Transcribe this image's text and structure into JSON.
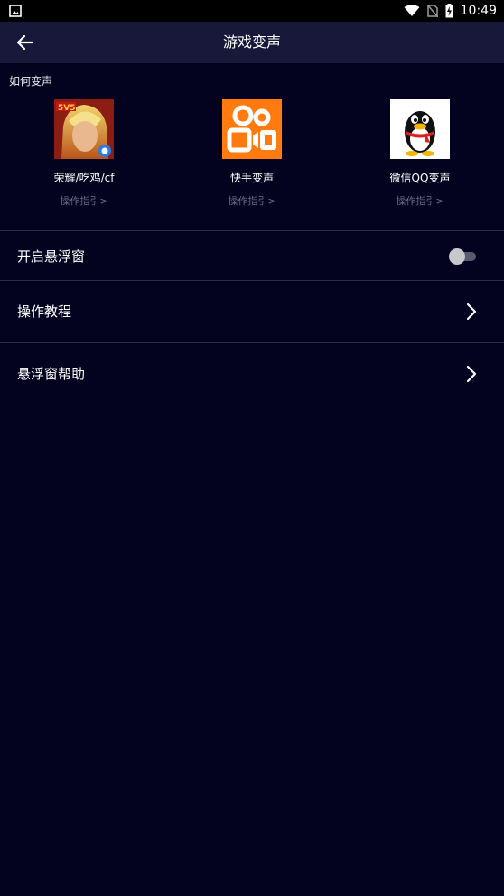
{
  "status_bar": {
    "time": "10:49",
    "icons": [
      "image-icon",
      "wifi-icon",
      "no-sim-icon",
      "battery-charging-icon"
    ]
  },
  "app_bar": {
    "title": "游戏变声",
    "back_icon": "arrow-left-icon"
  },
  "section": {
    "label": "如何变声"
  },
  "apps": [
    {
      "name": "荣耀/吃鸡/cf",
      "guide": "操作指引>",
      "icon": "game-hero-icon"
    },
    {
      "name": "快手变声",
      "guide": "操作指引>",
      "icon": "kuaishou-icon"
    },
    {
      "name": "微信QQ变声",
      "guide": "操作指引>",
      "icon": "qq-penguin-icon"
    }
  ],
  "settings": [
    {
      "label": "开启悬浮窗",
      "control": "toggle",
      "enabled": false
    },
    {
      "label": "操作教程",
      "control": "chevron-right-icon"
    },
    {
      "label": "悬浮窗帮助",
      "control": "chevron-right-icon"
    }
  ],
  "colors": {
    "background": "#03031f",
    "app_bar": "#17183a",
    "divider": "#2b2c4a",
    "kuaishou_orange": "#ff7a0f",
    "guide_text": "#6b6c86"
  }
}
